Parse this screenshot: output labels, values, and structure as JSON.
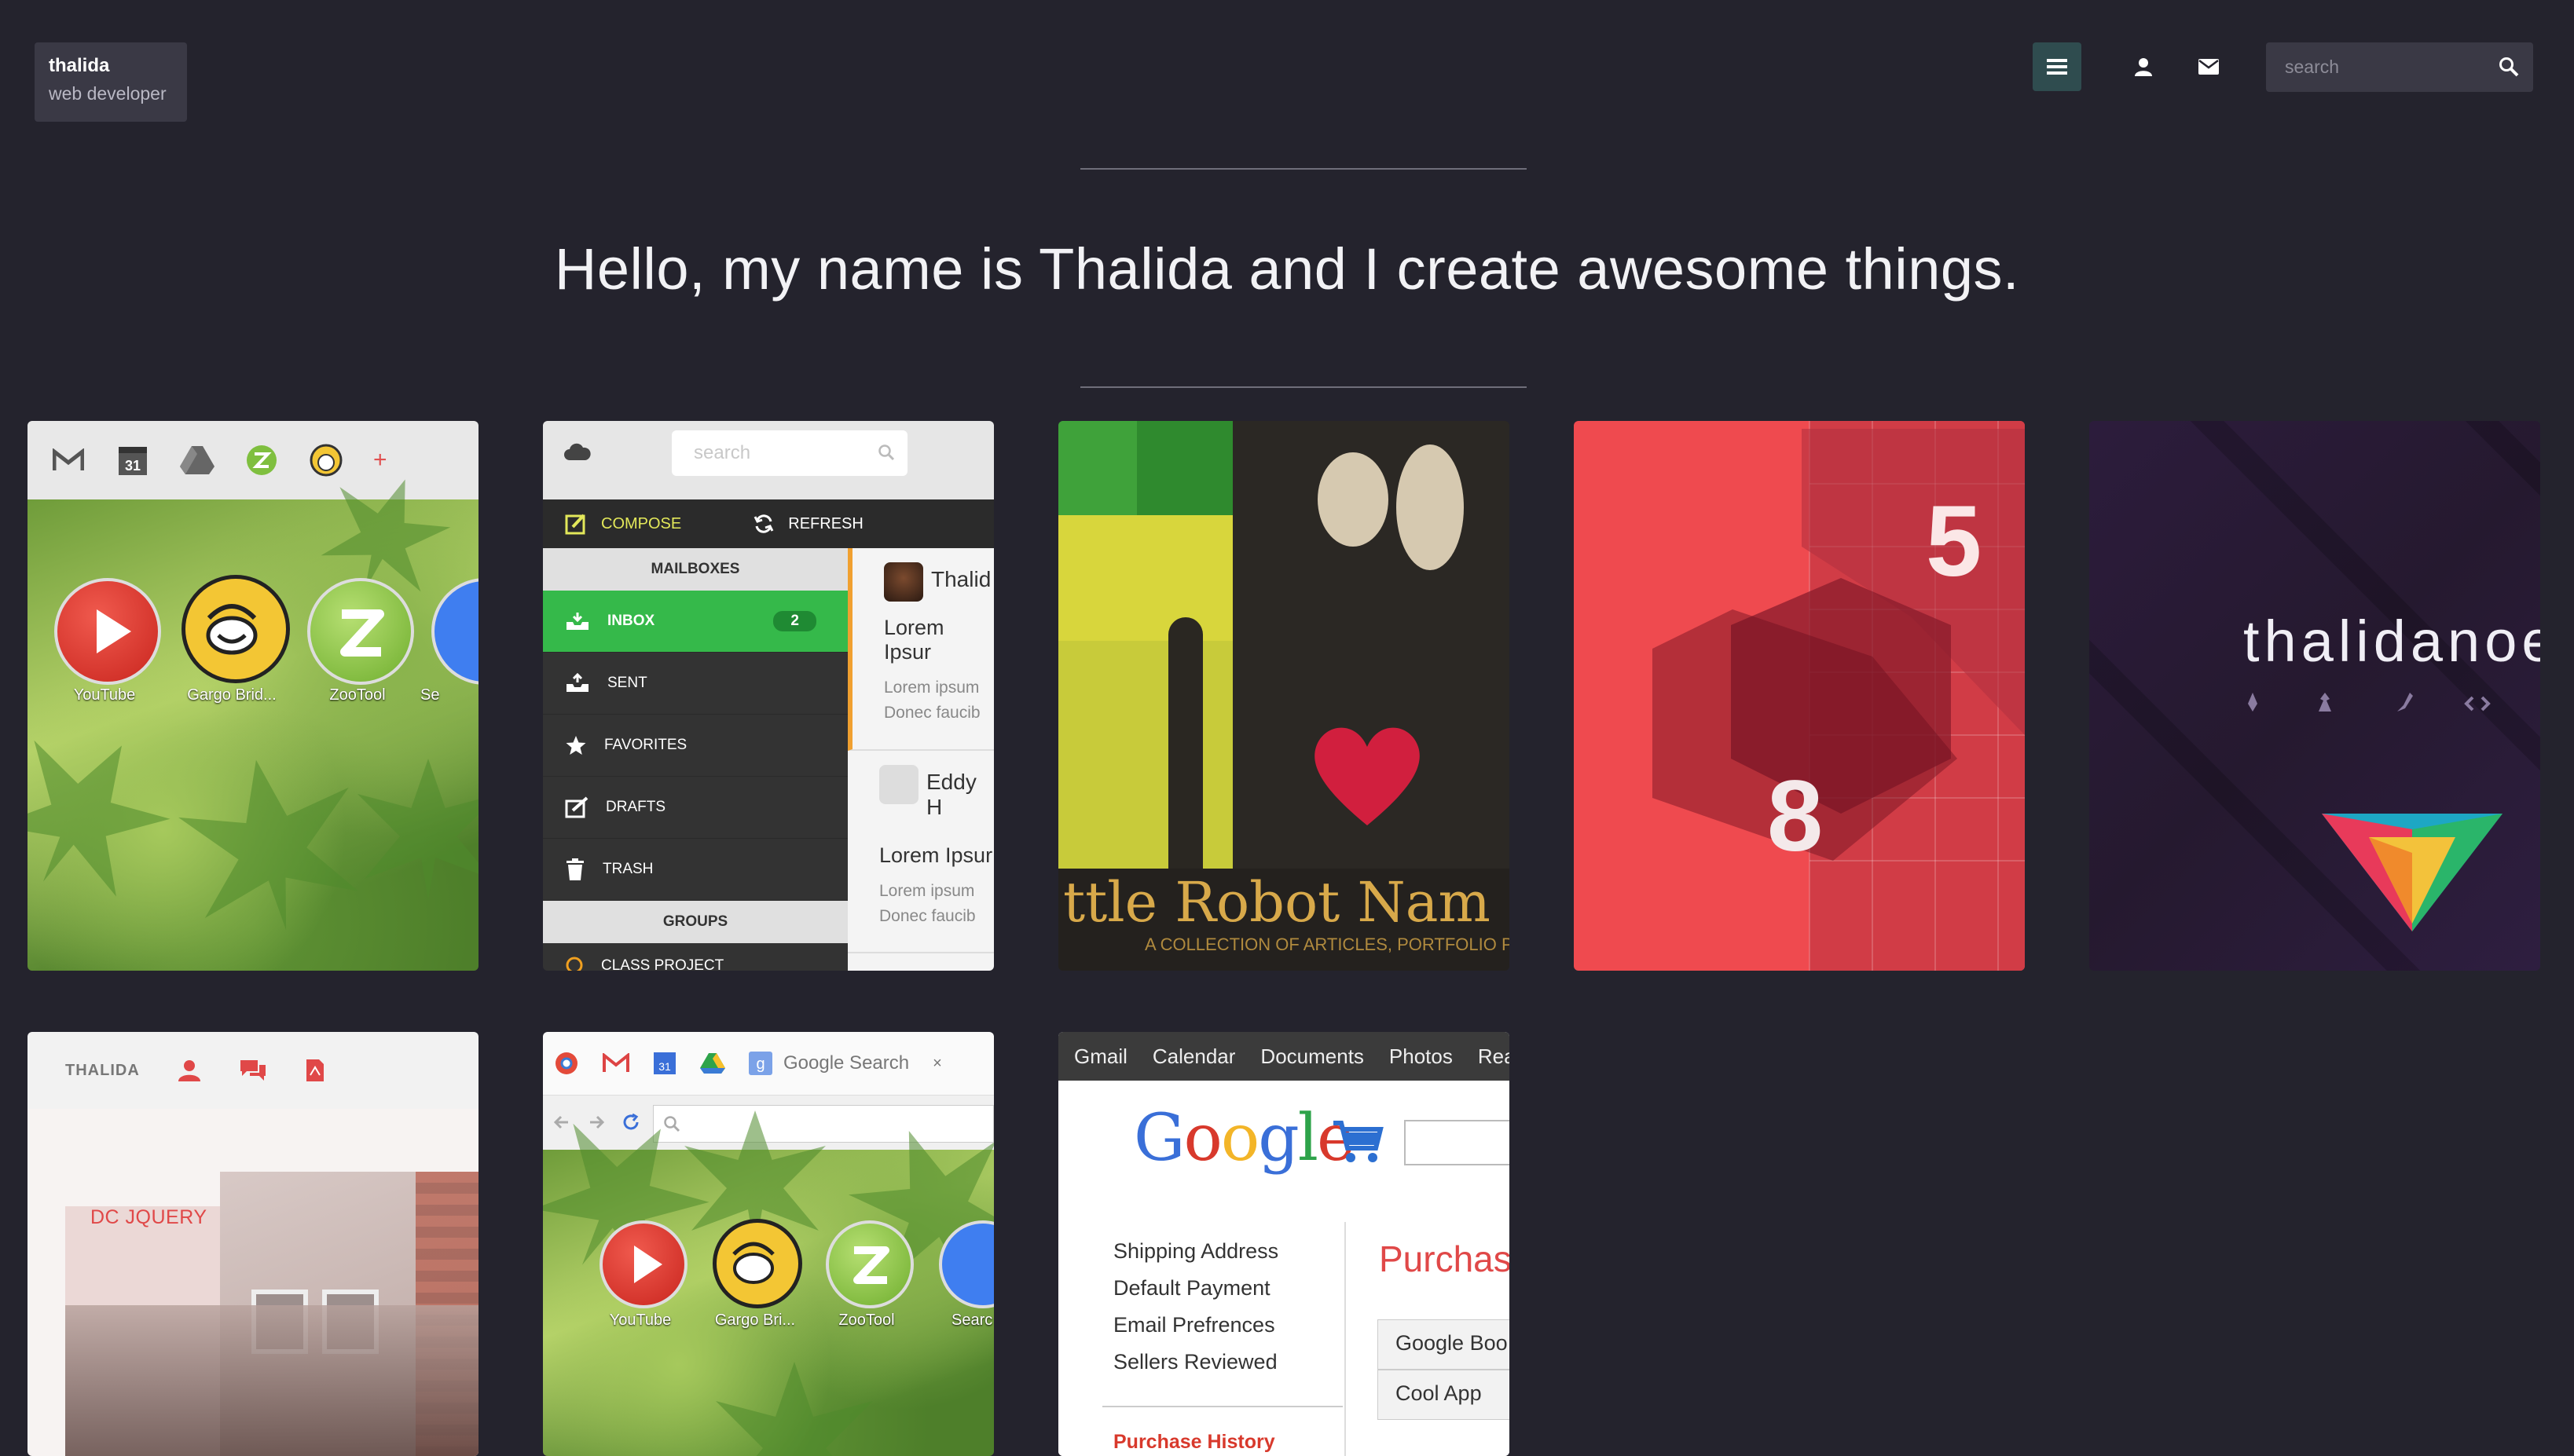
{
  "header": {
    "brand_name": "thalida",
    "brand_role": "web developer",
    "search_placeholder": "search"
  },
  "hero": {
    "headline": "Hello, my name is Thalida and I create awesome things."
  },
  "projects": {
    "chrome_newtab": {
      "apps": [
        "YouTube",
        "Gargo Brid...",
        "ZooTool",
        "Se"
      ],
      "calendar_day": "31"
    },
    "mail_app": {
      "search_placeholder": "search",
      "compose": "COMPOSE",
      "refresh": "REFRESH",
      "mailboxes_header": "MAILBOXES",
      "inbox": "INBOX",
      "inbox_count": "2",
      "sent": "SENT",
      "favorites": "FAVORITES",
      "drafts": "DRAFTS",
      "trash": "TRASH",
      "groups_header": "GROUPS",
      "group_item": "CLASS PROJECT",
      "messages": [
        {
          "from": "Thalid",
          "subject": "Lorem Ipsur",
          "preview1": "Lorem ipsum",
          "preview2": "Donec faucib"
        },
        {
          "from": "Eddy H",
          "subject": "Lorem Ipsur",
          "preview1": "Lorem ipsum",
          "preview2": "Donec faucib"
        }
      ]
    },
    "robot": {
      "title": "ttle Robot Nam",
      "subtitle": "A COLLECTION OF ARTICLES, PORTFOLIO PIECES"
    },
    "red_hex": {
      "num_top": "5",
      "num_mid": "8"
    },
    "purple_brand": {
      "wordmark": "thalidanoel"
    },
    "dc_jquery": {
      "nav_name": "THALIDA",
      "label": "DC JQUERY"
    },
    "chrome_newtab2": {
      "tab_label": "Google Search",
      "tab_close": "×",
      "calendar_day": "31",
      "apps": [
        "YouTube",
        "Gargo Bri...",
        "ZooTool",
        "Searc"
      ]
    },
    "google_store": {
      "nav": [
        "Gmail",
        "Calendar",
        "Documents",
        "Photos",
        "Reade"
      ],
      "logo": "Google",
      "links": [
        "Shipping Address",
        "Default Payment",
        "Email Prefrences",
        "Sellers Reviewed"
      ],
      "history": "Purchase History",
      "heading": "Purchas",
      "items": [
        "Google Boo",
        "Cool App"
      ]
    }
  },
  "colors": {
    "background": "#24232d",
    "panel": "#3a3945",
    "menu_active": "#2f4c4f",
    "accent_red": "#ef4a4f"
  }
}
